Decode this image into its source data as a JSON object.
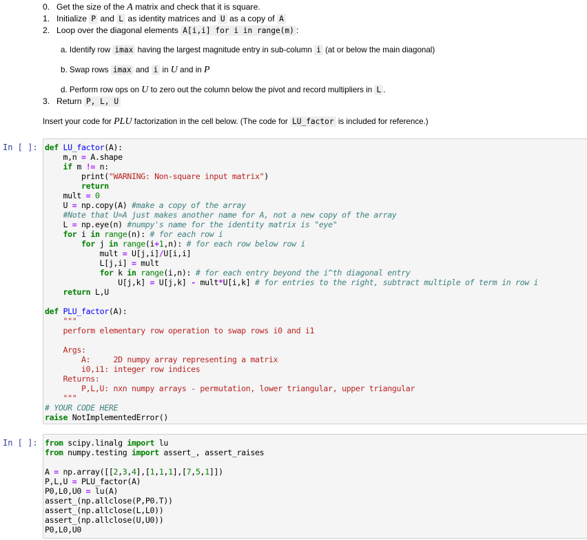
{
  "instructions": {
    "step0": {
      "num": "0.",
      "pre": "Get the size of the ",
      "math": "A",
      "post": " matrix and check that it is square."
    },
    "step1": {
      "num": "1.",
      "t1": "Initialize ",
      "c1": "P",
      "t2": " and ",
      "c2": "L",
      "t3": " as identity matrices and ",
      "c3": "U",
      "t4": " as a copy of ",
      "c4": "A"
    },
    "step2": {
      "num": "2.",
      "t1": "Loop over the diagonal elements ",
      "c1": "A[i,i] for i in range(m)",
      "t2": ":"
    },
    "sub_a": {
      "t1": "a. Identify row ",
      "c1": "imax",
      "t2": " having the largest magnitude entry in sub-column ",
      "c2": "i",
      "t3": " (at or below the main diagonal)"
    },
    "sub_b": {
      "t1": "b. Swap rows ",
      "c1": "imax",
      "t2": " and ",
      "c2": "i",
      "t3": " in ",
      "m1": "U",
      "t4": " and in ",
      "m2": "P"
    },
    "sub_d": {
      "t1": "d. Perform row ops on ",
      "m1": "U",
      "t2": " to zero out the column below the pivot and record multipliers in ",
      "c1": "L",
      "t3": "."
    },
    "step3": {
      "num": "3.",
      "t1": "Return ",
      "c1": "P, L, U"
    }
  },
  "insert_text": {
    "t1": "Insert your code for ",
    "m1": "PLU",
    "t2": " factorization in the cell below. (The code for ",
    "c1": "LU_factor",
    "t3": " is included for reference.)"
  },
  "cells": [
    {
      "prompt": "In [ ]:"
    },
    {
      "prompt": "In [ ]:"
    }
  ]
}
